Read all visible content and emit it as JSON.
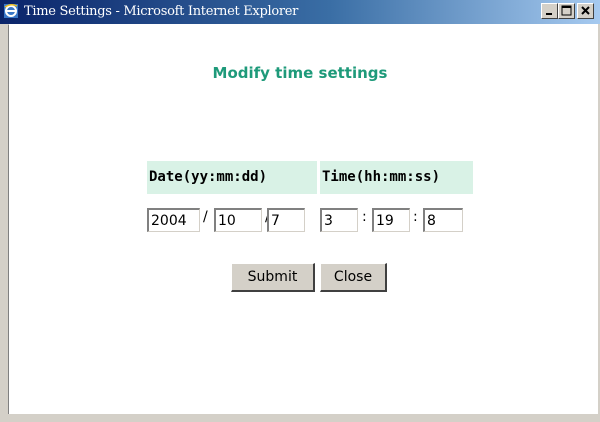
{
  "window": {
    "title": "Time Settings - Microsoft Internet Explorer",
    "controls": [
      "minimize",
      "maximize",
      "close"
    ]
  },
  "page": {
    "heading": "Modify time settings"
  },
  "date": {
    "header": "Date(yy:mm:dd)",
    "year": "2004",
    "month": "10",
    "day": "7",
    "separator": "/"
  },
  "time": {
    "header": "Time(hh:mm:ss)",
    "hour": "3",
    "minute": "19",
    "second": "8",
    "separator": ":"
  },
  "buttons": {
    "submit": "Submit",
    "close": "Close"
  },
  "colors": {
    "heading": "#1e9a7a",
    "header_bg": "#d9f2e6",
    "titlebar_start": "#0a246a",
    "titlebar_end": "#a6caf0"
  }
}
